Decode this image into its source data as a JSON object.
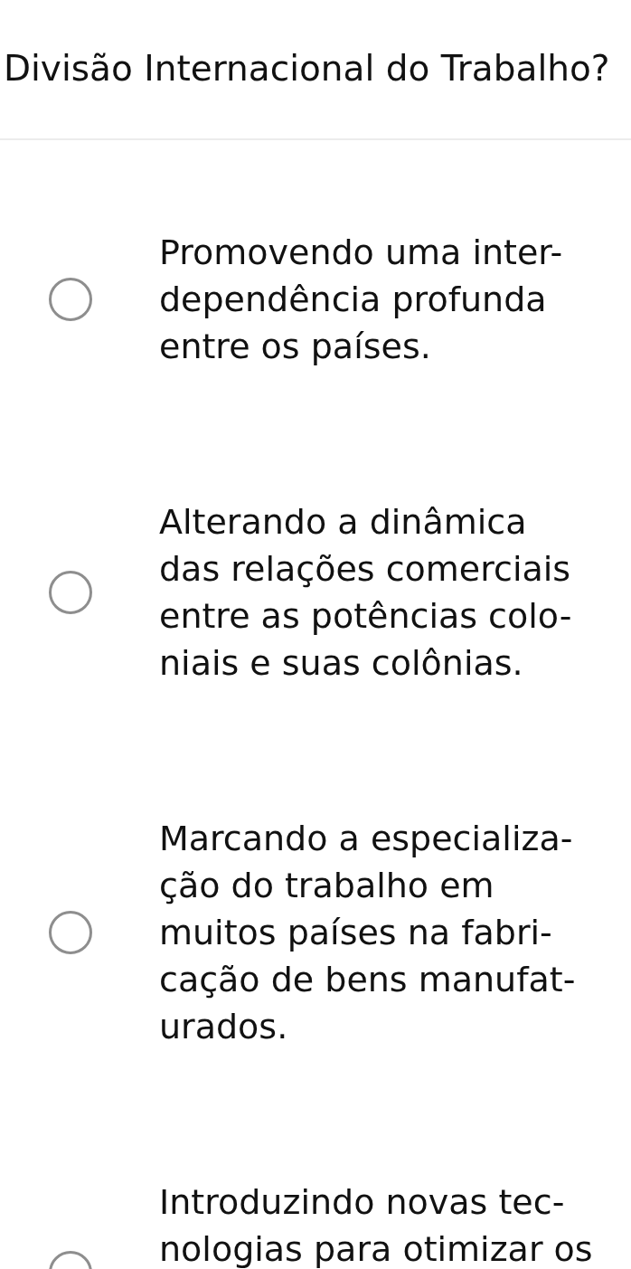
{
  "question": {
    "title": "Divisão Internacional do Trabalho?"
  },
  "options": [
    {
      "lines": [
        "Promovendo uma inter-",
        "dependência profunda",
        "entre os países."
      ],
      "selected": false
    },
    {
      "lines": [
        "Alterando a dinâmica",
        "das relações comerciais",
        "entre as potências colo-",
        "niais e suas colônias."
      ],
      "selected": false
    },
    {
      "lines": [
        "Marcando a especializa-",
        "ção do trabalho em",
        "muitos países na fabri-",
        "cação de bens manufat-",
        "urados."
      ],
      "selected": false
    },
    {
      "lines": [
        "Introduzindo novas tec-",
        "nologias para otimizar os"
      ],
      "selected": false
    }
  ]
}
